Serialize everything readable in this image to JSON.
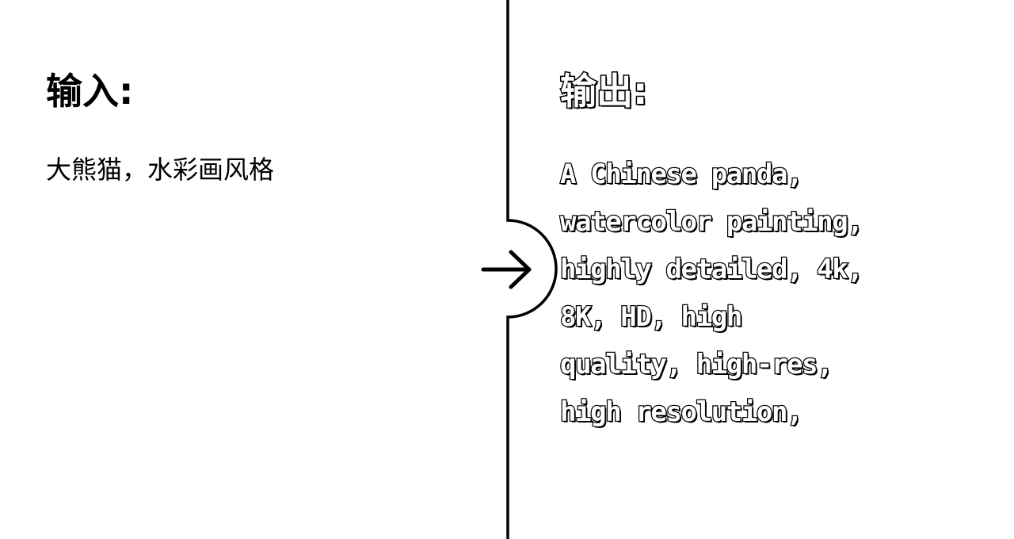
{
  "input_panel": {
    "heading": "输入:",
    "text": "大熊猫，水彩画风格"
  },
  "output_panel": {
    "heading": "输出:",
    "lines": [
      "A Chinese panda,",
      "watercolor painting,",
      "highly detailed, 4k,",
      "8K, HD, high",
      "quality, high-res,",
      "high resolution,"
    ]
  },
  "arrow": {
    "icon": "arrow-right-icon"
  },
  "colors": {
    "background": "#ffffff",
    "foreground": "#000000"
  }
}
